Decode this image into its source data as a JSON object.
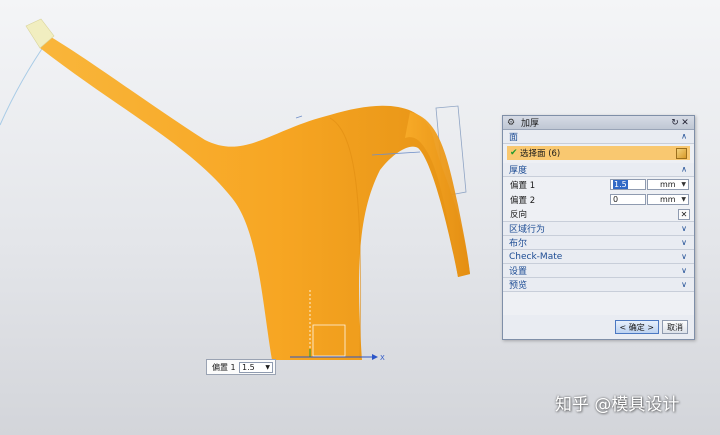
{
  "colors": {
    "body": "#f7a623",
    "body_shade": "#e08c10",
    "spout_tip": "#f1eec0",
    "accent": "#1d4c94",
    "selection": "#f9c870"
  },
  "dialog": {
    "title": "加厚",
    "sections": {
      "face": "面",
      "thickness": "厚度",
      "region": "区域行为",
      "boolean": "布尔",
      "checkmate": "Check-Mate",
      "settings": "设置",
      "preview": "预览"
    },
    "select_face": "选择面 (6)",
    "offset1": {
      "label": "偏置 1",
      "value": "1.5",
      "unit": "mm"
    },
    "offset2": {
      "label": "偏置 2",
      "value": "0",
      "unit": "mm"
    },
    "reverse": "反向",
    "ok": "< 确定 >",
    "cancel": "取消"
  },
  "callout": {
    "label": "偏置 1",
    "value": "1.5"
  },
  "axis": {
    "x": "X"
  },
  "watermark": "知乎 @模具设计"
}
